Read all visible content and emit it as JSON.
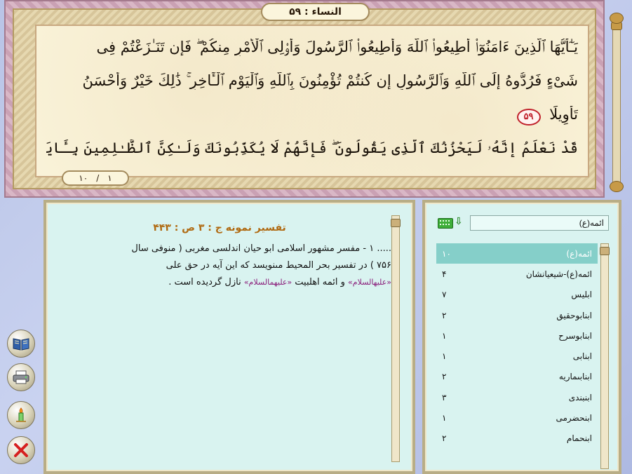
{
  "quran": {
    "sura_title": "النساء : ۵۹",
    "lines": [
      "يَـٰٓأَيُّهَا ٱلَّذِينَ ءَامَنُوٓا۟ أَطِيعُوا۟ ٱللَّهَ وَأَطِيعُوا۟ ٱلرَّسُولَ وَأُو۟لِى ٱلْأَمْرِ مِنكُمْ ۖ فَإِن تَنَـٰزَعْتُمْ فِى",
      "شَىْءٍ فَرُدُّوهُ إِلَى ٱللَّهِ وَٱلرَّسُولِ إِن كُنتُمْ تُؤْمِنُونَ بِٱللَّهِ وَٱلْيَوْمِ ٱلْـَٔاخِرِ ۚ ذَٰلِكَ خَيْرٌ وَأَحْسَنُ",
      "تَأْوِيلًا",
      "قَدْ نَعْلَمُ إِنَّهُۥ لَيَحْزُنُكَ ٱلَّذِى يَقُولُونَ ۖ فَإِنَّهُمْ لَا يُكَذِّبُونَكَ وَلَـٰكِنَّ ٱلظَّـٰلِمِينَ بِـَٔايَـٰتِ ٱللَّهِ"
    ],
    "ayah_number": "۵۹",
    "page_current": "۱",
    "page_separator": "/",
    "page_total": "۱۰"
  },
  "tafsir": {
    "heading": "تفسير نمونه ج : ۳ ص : ۴۴۳",
    "line1": "..... ۱ - مفسر مشهور اسلامى ابو حيان اندلسى مغربى ( منوفى سال",
    "line2": "۷۵۶ ) در تفسير بحر المحيط مى‏نويسد كه اين آيه در حق على",
    "salam1": "«عليه‏السلام»",
    "line3_mid": " و ائمه اهلبيت ",
    "salam2": "«عليهم‏السلام»",
    "line3_end": " نازل گرديده است ."
  },
  "index": {
    "search_value": "ائمه(ع)",
    "items": [
      {
        "label": "ائمه(ع)",
        "count": "۱۰"
      },
      {
        "label": "ائمه(ع)-شيعيانشان",
        "count": "۴"
      },
      {
        "label": "ابليس",
        "count": "۷"
      },
      {
        "label": "ابن‏ابوحقيق",
        "count": "۲"
      },
      {
        "label": "ابن‏ابوسرح",
        "count": "۱"
      },
      {
        "label": "ابن‏ابى",
        "count": "۱"
      },
      {
        "label": "ابن‏ابى‏ماريه",
        "count": "۲"
      },
      {
        "label": "ابن‏بندى",
        "count": "۳"
      },
      {
        "label": "ابن‏حضرمى",
        "count": "۱"
      },
      {
        "label": "ابن‏حمام",
        "count": "۲"
      }
    ],
    "selected_index": 0
  },
  "tools": [
    "book-icon",
    "print-icon",
    "candle-icon",
    "close-icon"
  ],
  "colors": {
    "accent": "#b06a12",
    "selection": "#85cfc9",
    "salam": "#8a1d7a",
    "ayah_marker": "#c0202a"
  }
}
